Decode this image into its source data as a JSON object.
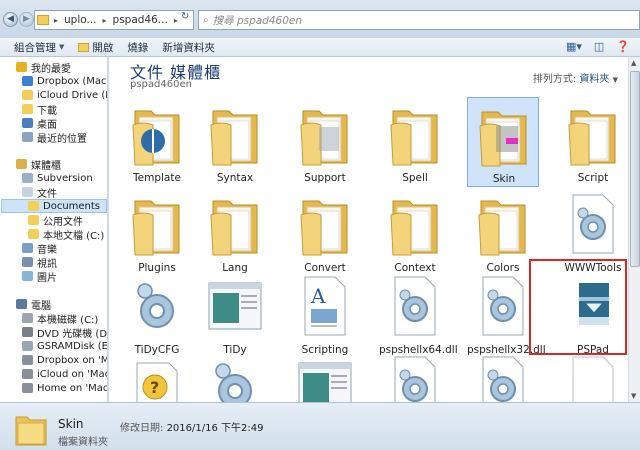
{
  "address": {
    "crumbs": [
      "uplo...",
      "pspad46...",
      "▸"
    ],
    "search_placeholder": "搜尋 pspad460en"
  },
  "toolbar": {
    "organize": "組合管理",
    "open": "開啟",
    "burn": "燒錄",
    "new_folder": "新增資料夾"
  },
  "nav": {
    "favorites": "我的最愛",
    "fav_items": [
      "Dropbox (Mac)",
      "iCloud Drive (Mac",
      "下載",
      "桌面",
      "最近的位置"
    ],
    "libraries": "媒體櫃",
    "lib_items": [
      "Subversion",
      "文件",
      "Documents",
      "公用文件",
      "本地文檔 (C:)",
      "音樂",
      "視訊",
      "圖片"
    ],
    "computer": "電腦",
    "comp_items": [
      "本機磁碟 (C:)",
      "DVD 光碟機 (D:) P",
      "GSRAMDisk (E:)",
      "Dropbox on 'Mac'",
      "iCloud on 'Mac' (",
      "Home on 'Mac' (Z"
    ]
  },
  "content": {
    "title": "文件 媒體櫃",
    "subtitle": "pspad460en",
    "arrange_label": "排列方式:",
    "arrange_value": "資料夾",
    "items": [
      {
        "label": "Template",
        "kind": "folder"
      },
      {
        "label": "Syntax",
        "kind": "folder"
      },
      {
        "label": "Support",
        "kind": "folder"
      },
      {
        "label": "Spell",
        "kind": "folder"
      },
      {
        "label": "Skin",
        "kind": "folder"
      },
      {
        "label": "Script",
        "kind": "folder"
      },
      {
        "label": "Plugins",
        "kind": "folder"
      },
      {
        "label": "Lang",
        "kind": "folder"
      },
      {
        "label": "Convert",
        "kind": "folder"
      },
      {
        "label": "Context",
        "kind": "folder"
      },
      {
        "label": "Colors",
        "kind": "folder"
      },
      {
        "label": "WWWTools",
        "kind": "gear-file"
      },
      {
        "label": "TiDyCFG",
        "kind": "gear"
      },
      {
        "label": "TiDy",
        "kind": "window"
      },
      {
        "label": "Scripting",
        "kind": "doc"
      },
      {
        "label": "pspshellx64.dll",
        "kind": "gear-file"
      },
      {
        "label": "pspshellx32.dll",
        "kind": "gear-file"
      },
      {
        "label": "PSPad",
        "kind": "app"
      },
      {
        "label": "",
        "kind": "help"
      },
      {
        "label": "",
        "kind": "gear"
      },
      {
        "label": "",
        "kind": "window"
      },
      {
        "label": "",
        "kind": "gear-file"
      },
      {
        "label": "",
        "kind": "gear-file"
      },
      {
        "label": "",
        "kind": "blank-file"
      }
    ]
  },
  "details": {
    "name": "Skin",
    "type": "檔案資料夾",
    "date_label": "修改日期:",
    "date_value": "2016/1/16 下午2:49"
  }
}
